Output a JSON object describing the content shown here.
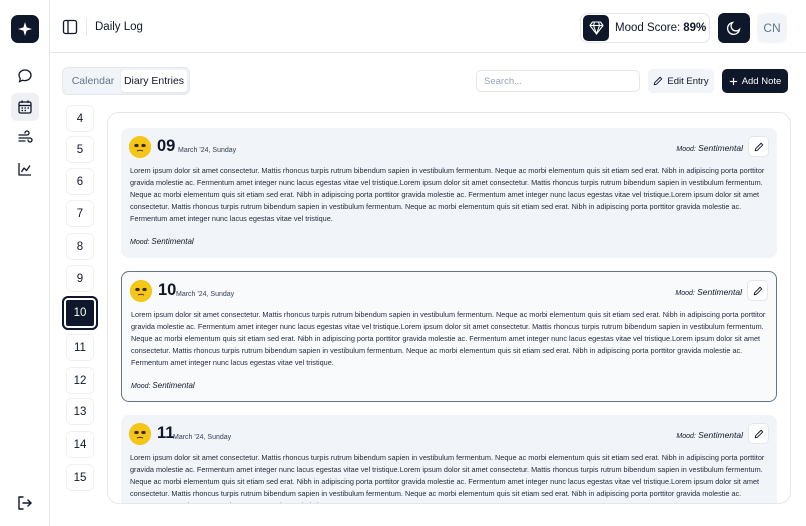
{
  "app": {
    "title": "Daily Log"
  },
  "header": {
    "mood_label": "Mood Score:",
    "mood_value": "89%",
    "avatar": "CN"
  },
  "sidebar": {
    "items": [
      {
        "icon": "chat-icon"
      },
      {
        "icon": "calendar-icon",
        "active": true
      },
      {
        "icon": "wind-icon"
      },
      {
        "icon": "chart-icon"
      }
    ],
    "bottom_icon": "logout-icon"
  },
  "toolbar": {
    "tabs": [
      "Calendar",
      "Diary Entries"
    ],
    "active_tab": "Diary Entries",
    "search_placeholder": "Search...",
    "edit_label": "Edit Entry",
    "add_label": "Add Note"
  },
  "days": [
    "4",
    "5",
    "6",
    "7",
    "8",
    "9",
    "10",
    "11",
    "12",
    "13",
    "14",
    "15"
  ],
  "selected_day": "10",
  "entries": [
    {
      "day": "09",
      "date": "March '24, Sunday",
      "mood_label": "Mood:",
      "mood": "Sentimental",
      "text": "Lorem ipsum dolor sit amet consectetur. Mattis rhoncus turpis rutrum bibendum sapien in vestibulum fermentum. Neque ac morbi elementum quis sit etiam sed erat. Nibh in adipiscing porta porttitor gravida molestie ac. Fermentum amet integer nunc lacus egestas vitae vel tristique.Lorem ipsum dolor sit amet consectetur. Mattis rhoncus turpis rutrum bibendum sapien in vestibulum fermentum. Neque ac morbi elementum quis sit etiam sed erat. Nibh in adipiscing porta porttitor gravida molestie ac. Fermentum amet integer nunc lacus egestas vitae vel tristique.Lorem ipsum dolor sit amet consectetur. Mattis rhoncus turpis rutrum bibendum sapien in vestibulum fermentum. Neque ac morbi elementum quis sit etiam sed erat. Nibh in adipiscing porta porttitor gravida molestie ac. Fermentum amet integer nunc lacus egestas vitae vel tristique."
    },
    {
      "day": "10",
      "date": "March '24, Sunday",
      "mood_label": "Mood:",
      "mood": "Sentimental",
      "text": "Lorem ipsum dolor sit amet consectetur. Mattis rhoncus turpis rutrum bibendum sapien in vestibulum fermentum. Neque ac morbi elementum quis sit etiam sed erat. Nibh in adipiscing porta porttitor gravida molestie ac. Fermentum amet integer nunc lacus egestas vitae vel tristique.Lorem ipsum dolor sit amet consectetur. Mattis rhoncus turpis rutrum bibendum sapien in vestibulum fermentum. Neque ac morbi elementum quis sit etiam sed erat. Nibh in adipiscing porta porttitor gravida molestie ac. Fermentum amet integer nunc lacus egestas vitae vel tristique.Lorem ipsum dolor sit amet consectetur. Mattis rhoncus turpis rutrum bibendum sapien in vestibulum fermentum. Neque ac morbi elementum quis sit etiam sed erat. Nibh in adipiscing porta porttitor gravida molestie ac. Fermentum amet integer nunc lacus egestas vitae vel tristique."
    },
    {
      "day": "11",
      "date": "March '24, Sunday",
      "mood_label": "Mood:",
      "mood": "Sentimental",
      "text": "Lorem ipsum dolor sit amet consectetur. Mattis rhoncus turpis rutrum bibendum sapien in vestibulum fermentum. Neque ac morbi elementum quis sit etiam sed erat. Nibh in adipiscing porta porttitor gravida molestie ac. Fermentum amet integer nunc lacus egestas vitae vel tristique.Lorem ipsum dolor sit amet consectetur. Mattis rhoncus turpis rutrum bibendum sapien in vestibulum fermentum. Neque ac morbi elementum quis sit etiam sed erat. Nibh in adipiscing porta porttitor gravida molestie ac. Fermentum amet integer nunc lacus egestas vitae vel tristique.Lorem ipsum dolor sit amet consectetur. Mattis rhoncus turpis rutrum bibendum sapien in vestibulum fermentum. Neque ac morbi elementum quis sit etiam sed erat. Nibh in adipiscing porta porttitor gravida molestie ac. Fermentum amet integer nunc lacus egestas vitae vel tristique."
    }
  ],
  "colors": {
    "primary": "#0f172a",
    "muted": "#f1f4f8",
    "border": "#e5e7eb",
    "emoji": "#f5c518"
  }
}
